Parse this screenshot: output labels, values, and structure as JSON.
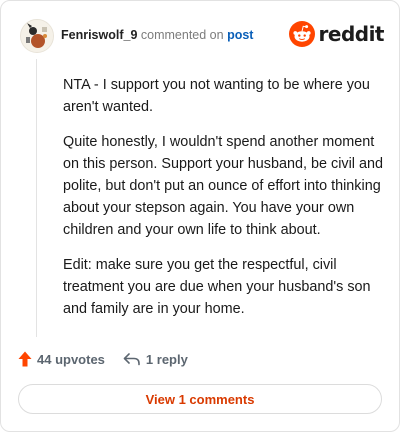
{
  "comment": {
    "author": "Fenriswolf_9",
    "action_text": "commented on",
    "post_link_label": "post",
    "brand": {
      "wordmark": "reddit",
      "icon": "reddit-snoo-icon",
      "color": "#FF4500"
    },
    "paragraphs": [
      "NTA - I support you not wanting to be where you aren't wanted.",
      "Quite honestly, I wouldn't spend another moment on this person. Support your husband, be civil and polite, but don't put an ounce of effort into thinking about your stepson again. You have your own children and your own life to think about.",
      "Edit: make sure you get the respectful, civil treatment you are due when your husband's son and family are in your home."
    ],
    "upvotes_label": "44 upvotes",
    "upvote_icon": "upvote-arrow-icon",
    "replies_label": "1 reply",
    "reply_icon": "reply-arrow-icon",
    "view_comments_label": "View 1 comments"
  },
  "colors": {
    "accent": "#D93A00",
    "upvote": "#FF4500",
    "link": "#0A5FB8",
    "text": "#1A1A1A",
    "muted": "#7C7C7C"
  }
}
